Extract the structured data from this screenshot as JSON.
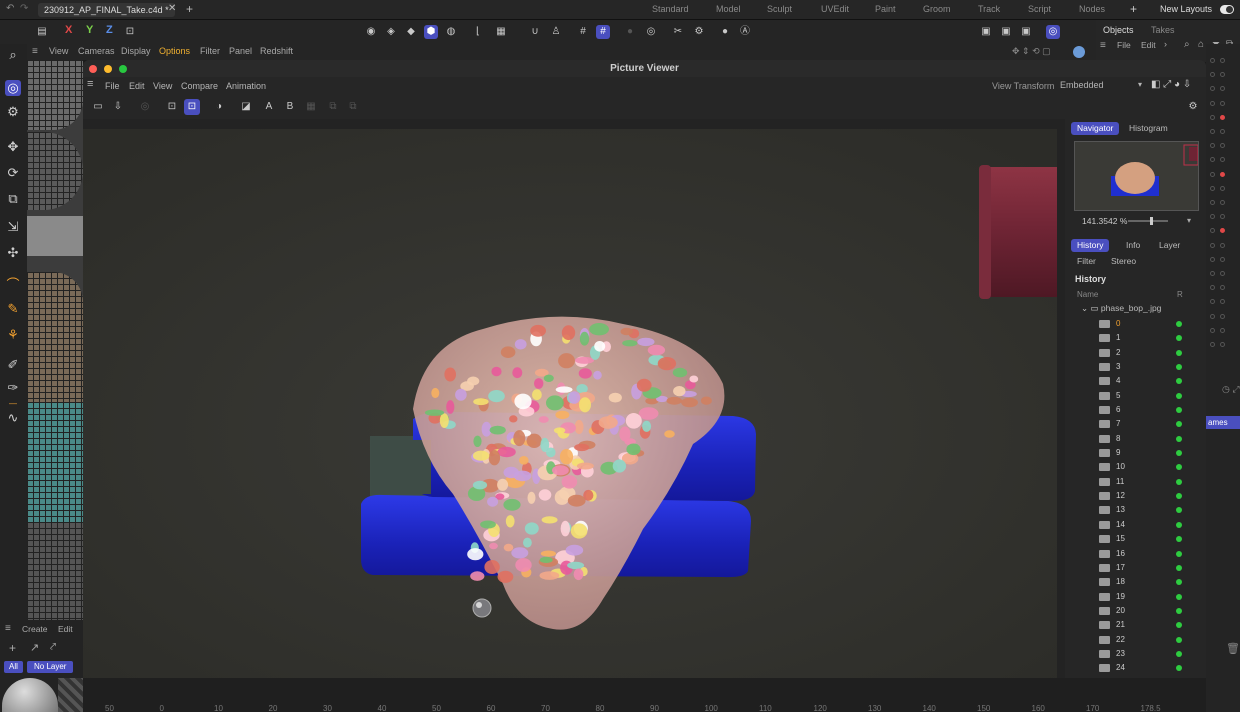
{
  "top": {
    "file_tab": "230912_AP_FINAL_Take.c4d *",
    "layouts": [
      "Standard",
      "Model",
      "Sculpt",
      "UVEdit",
      "Paint",
      "Groom",
      "Track",
      "Script",
      "Nodes"
    ],
    "new_layouts": "New Layouts"
  },
  "axes": {
    "x": "X",
    "y": "Y",
    "z": "Z"
  },
  "objects_panel": {
    "objects": "Objects",
    "takes": "Takes",
    "file": "File",
    "edit": "Edit"
  },
  "viewport_menu": [
    "View",
    "Cameras",
    "Display",
    "Options",
    "Filter",
    "Panel",
    "Redshift"
  ],
  "picture_viewer": {
    "title": "Picture Viewer",
    "menu": [
      "File",
      "Edit",
      "View",
      "Compare",
      "Animation"
    ],
    "view_transform_label": "View Transform",
    "view_transform_value": "Embedded",
    "compare_a": "A",
    "compare_b": "B"
  },
  "right_panel": {
    "tab_navigator": "Navigator",
    "tab_histogram": "Histogram",
    "zoom": "141.3542 %",
    "tab_history": "History",
    "tab_info": "Info",
    "tab_layer": "Layer",
    "tab_filter": "Filter",
    "tab_stereo": "Stereo",
    "history_heading": "History",
    "col_name": "Name",
    "col_r": "R",
    "folder": "phase_bop_.jpg",
    "frames": [
      "0",
      "1",
      "2",
      "3",
      "4",
      "5",
      "6",
      "7",
      "8",
      "9",
      "10",
      "11",
      "12",
      "13",
      "14",
      "15",
      "16",
      "17",
      "18",
      "19",
      "20",
      "21",
      "22",
      "23",
      "24"
    ]
  },
  "side_right_label": "ames",
  "bottom_left": {
    "create": "Create",
    "edit": "Edit",
    "all": "All",
    "no_layer": "No Layer"
  },
  "timeline": [
    "50",
    "0",
    "10",
    "20",
    "30",
    "40",
    "50",
    "60",
    "70",
    "80",
    "90",
    "100",
    "110",
    "120",
    "130",
    "140",
    "150",
    "160",
    "170",
    "178.5"
  ],
  "colors": {
    "accent": "#4a4fbf",
    "frame_dot": "#2ecc40",
    "brick": "#1f2fd0"
  }
}
